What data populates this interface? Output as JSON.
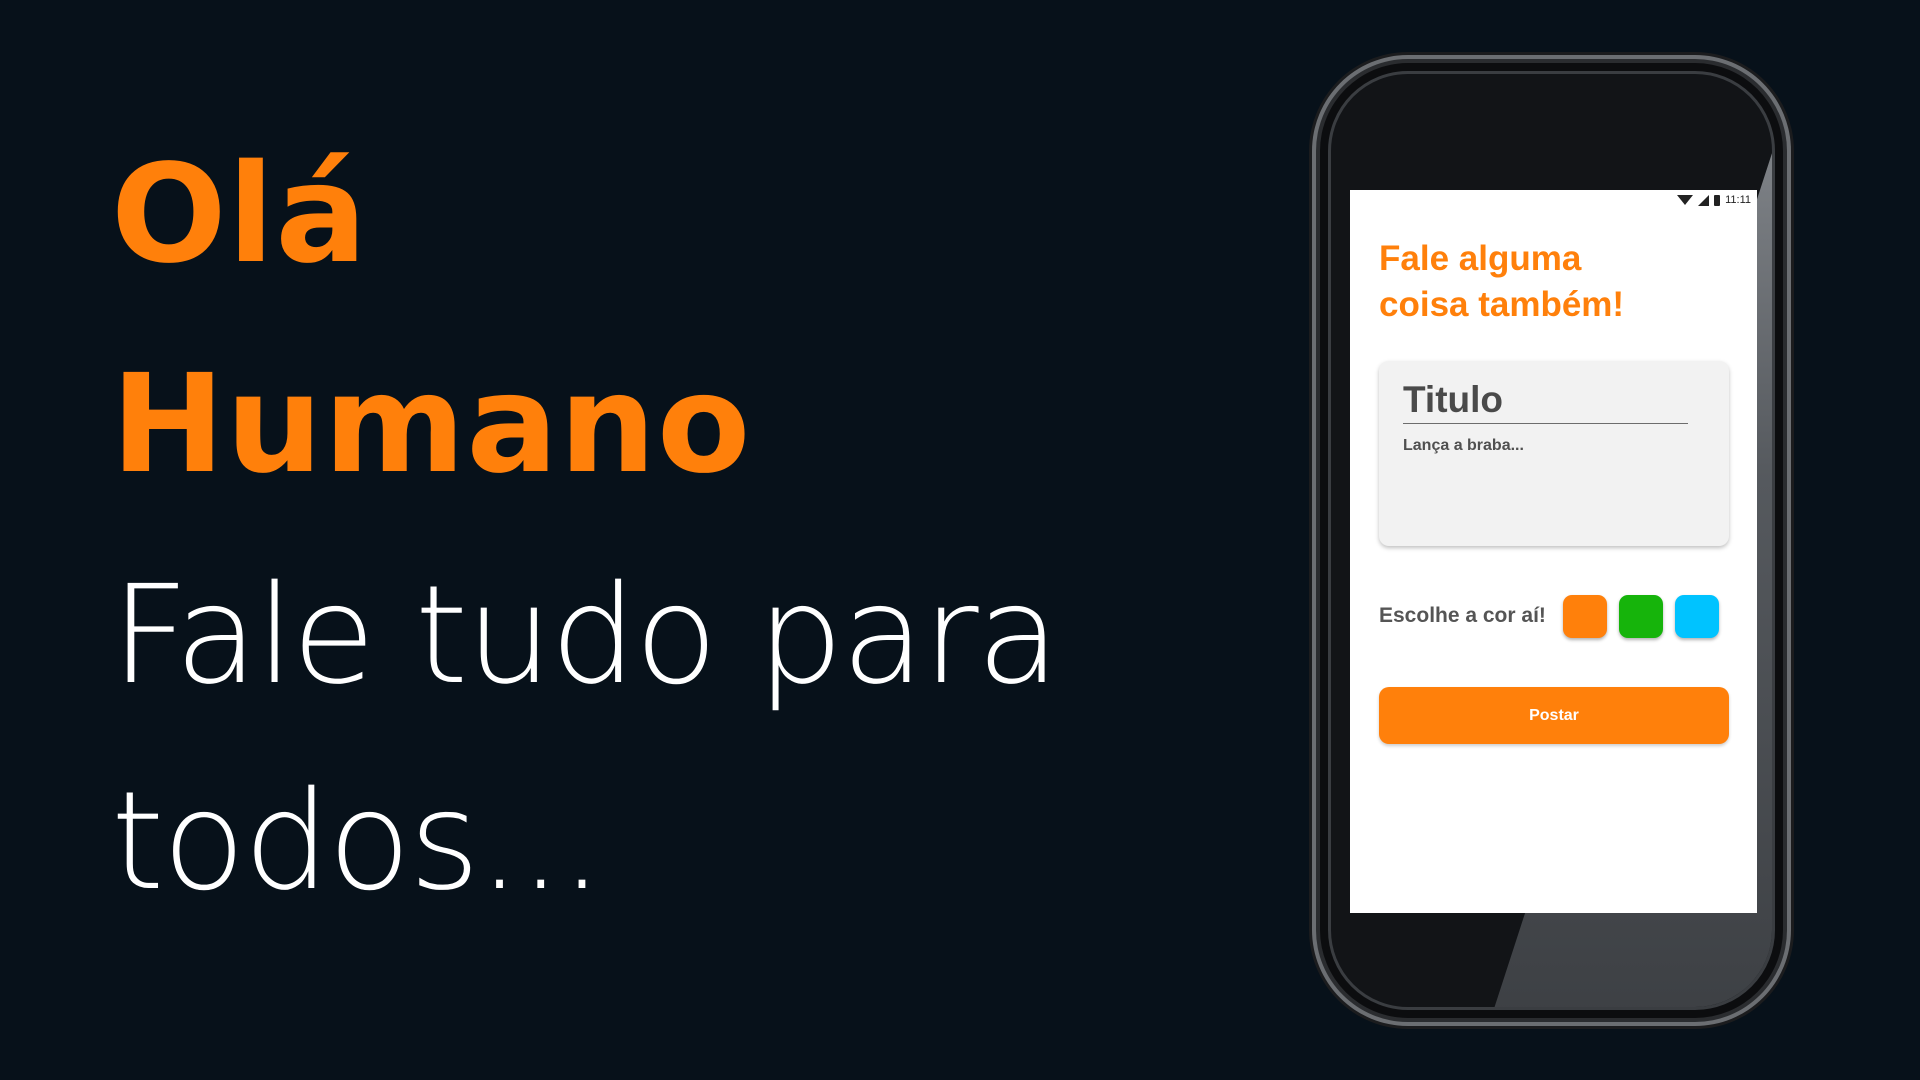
{
  "hero": {
    "line1": "Olá",
    "line2": "Humano",
    "sub1": "Fale tudo para",
    "sub2": "todos..."
  },
  "phone": {
    "status": {
      "time": "11:11",
      "icons": [
        "wifi-icon",
        "signal-icon",
        "battery-icon"
      ]
    },
    "title_line1": "Fale alguma",
    "title_line2": "coisa também!",
    "form": {
      "title_placeholder": "Titulo",
      "body_placeholder": "Lança a braba..."
    },
    "color_label": "Escolhe a cor aí!",
    "colors": [
      "#ff800b",
      "#16b40b",
      "#00c3ff"
    ],
    "post_label": "Postar"
  },
  "theme": {
    "background": "#07111a",
    "accent": "#ff800b",
    "text": "#ffffff"
  }
}
